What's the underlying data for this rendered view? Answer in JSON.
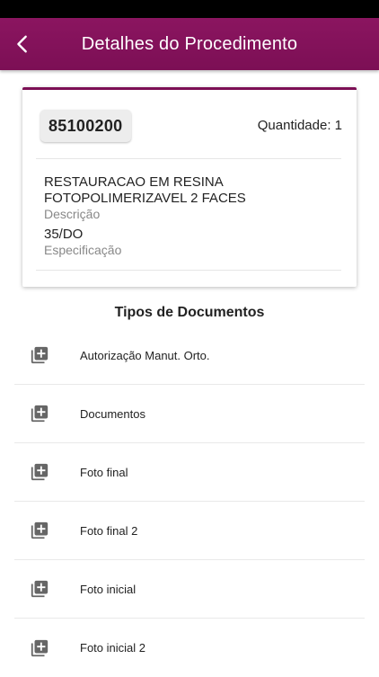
{
  "header": {
    "title": "Detalhes do Procedimento",
    "back_icon": "chevron-left-icon"
  },
  "procedure": {
    "code": "85100200",
    "quantity_text": "Quantidade: 1",
    "description": "RESTAURACAO EM RESINA\nFOTOPOLIMERIZAVEL  2 FACES",
    "description_label": "Descrição",
    "specification": "35/DO",
    "specification_label": "Especificação"
  },
  "documents": {
    "title": "Tipos de Documentos",
    "item_icon": "add-to-library-icon",
    "items": [
      {
        "label": "Autorização Manut. Orto."
      },
      {
        "label": "Documentos"
      },
      {
        "label": "Foto final"
      },
      {
        "label": "Foto final 2"
      },
      {
        "label": "Foto inicial"
      },
      {
        "label": "Foto inicial 2"
      }
    ]
  },
  "colors": {
    "brand": "#7c0f55",
    "icon": "#666666"
  }
}
